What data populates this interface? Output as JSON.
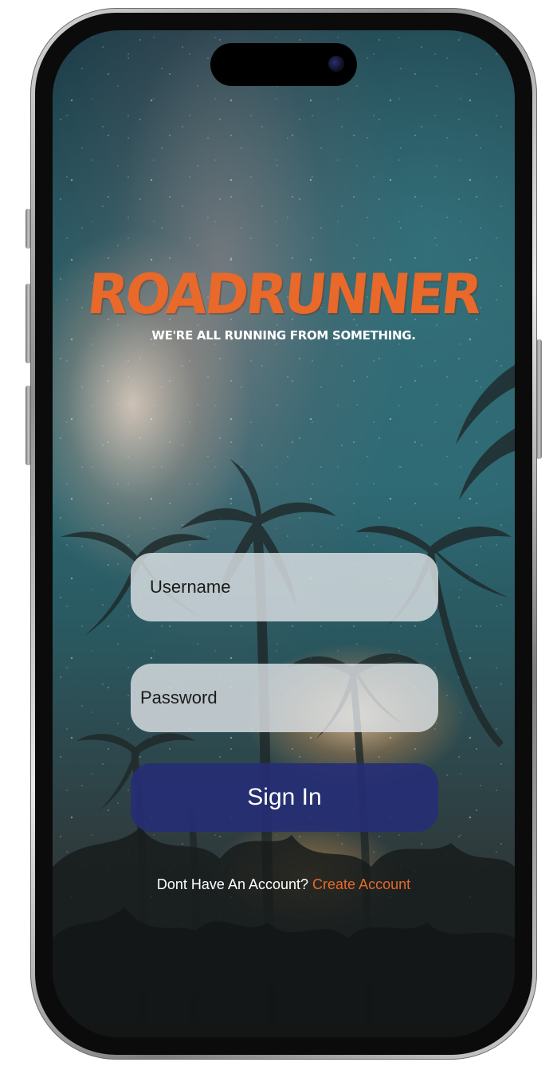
{
  "app": {
    "logo_text": "ROADRUNNER",
    "tagline": "WE'RE ALL RUNNING FROM SOMETHING."
  },
  "login": {
    "username_placeholder": "Username",
    "password_placeholder": "Password",
    "signin_label": "Sign In"
  },
  "footer": {
    "prompt": "Dont Have An Account?",
    "create_link": "Create Account"
  },
  "colors": {
    "accent": "#e8692a",
    "button": "#262e76"
  },
  "icons": {
    "camera": "front-camera-icon"
  }
}
